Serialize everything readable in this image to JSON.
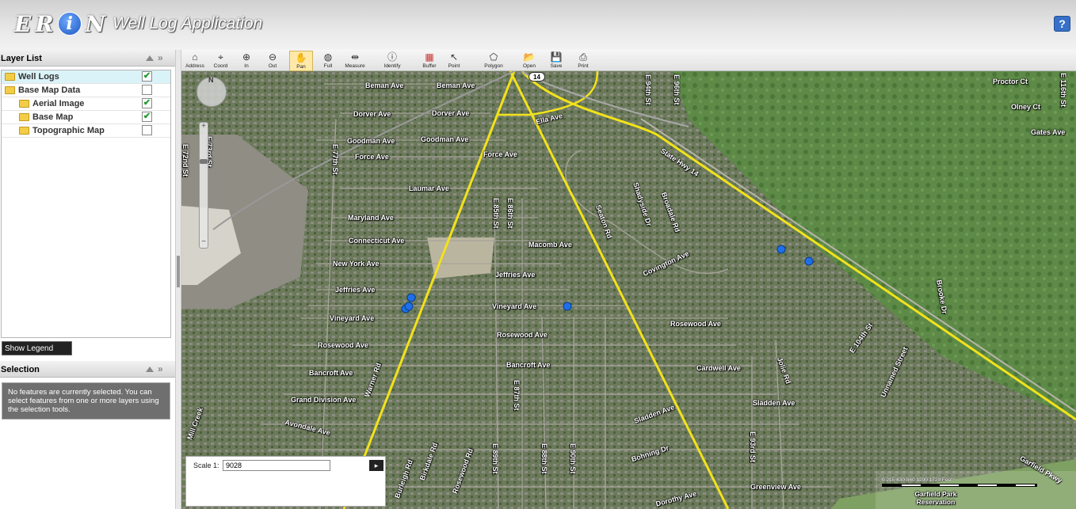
{
  "app": {
    "logo_letters": [
      "E",
      "R",
      "i",
      "N"
    ],
    "title": "Well Log Application",
    "help_label": "?"
  },
  "layer_list": {
    "title": "Layer List",
    "items": [
      {
        "label": "Well Logs",
        "checked": true,
        "selected": true
      },
      {
        "label": "Base Map Data",
        "checked": false
      },
      {
        "label": "Aerial Image",
        "checked": true
      },
      {
        "label": "Base Map",
        "checked": true
      },
      {
        "label": "Topographic Map",
        "checked": false
      }
    ],
    "show_legend_label": "Show Legend"
  },
  "selection": {
    "title": "Selection",
    "message": "No features are currently selected. You can select features from one or more layers using the selection tools."
  },
  "toolbar": {
    "tools": [
      {
        "label": "Address",
        "icon": "address-icon"
      },
      {
        "label": "Coord",
        "icon": "coord-icon"
      },
      {
        "label": "In",
        "icon": "zoom-in-icon"
      },
      {
        "label": "Out",
        "icon": "zoom-out-icon"
      },
      {
        "label": "Pan",
        "icon": "pan-icon",
        "active": true
      },
      {
        "label": "Full",
        "icon": "full-extent-icon"
      },
      {
        "label": "Measure",
        "icon": "measure-icon"
      },
      {
        "label": "Identify",
        "icon": "identify-icon"
      },
      {
        "label": "Buffer",
        "icon": "buffer-icon"
      },
      {
        "label": "Point",
        "icon": "point-icon"
      },
      {
        "label": "Polygon",
        "icon": "polygon-icon"
      },
      {
        "label": "Open",
        "icon": "open-icon"
      },
      {
        "label": "Save",
        "icon": "save-icon"
      },
      {
        "label": "Print",
        "icon": "print-icon"
      }
    ]
  },
  "map": {
    "nav_label": "N",
    "zoom_in": "+",
    "zoom_out": "−",
    "route_shield": "14",
    "scale_label": "Scale 1:",
    "scale_value": "9028",
    "scale_go": "▸",
    "scalebar_ticks": "0    215    430    860    1290    1720 Feet",
    "street_labels": {
      "beman1": "Beman Ave",
      "beman2": "Beman Ave",
      "dorver1": "Dorver Ave",
      "dorver2": "Dorver Ave",
      "goodman1": "Goodman Ave",
      "goodman2": "Goodman Ave",
      "force1": "Force Ave",
      "force2": "Force Ave",
      "laumar": "Laumar Ave",
      "maryland": "Maryland Ave",
      "connecticut": "Connecticut Ave",
      "newyork": "New York Ave",
      "jeffries1": "Jeffries Ave",
      "jeffries2": "Jeffries Ave",
      "vineyard1": "Vineyard Ave",
      "vineyard2": "Vineyard Ave",
      "rosewood1": "Rosewood Ave",
      "rosewood2": "Rosewood Ave",
      "rosewood3": "Rosewood Ave",
      "bancroft1": "Bancroft Ave",
      "bancroft2": "Bancroft Ave",
      "granddiv": "Grand Division Ave",
      "avondale": "Avondale Ave",
      "macomb": "Macomb Ave",
      "covington": "Covington Ave",
      "cardwell": "Cardwell Ave",
      "sladden1": "Sladden Ave",
      "sladden2": "Sladden Ave",
      "bohning": "Bohning Dr",
      "dorothy": "Dorothy Ave",
      "greenview": "Greenview Ave",
      "ella": "Ella Ave",
      "proctor": "Proctor Ct",
      "olney": "Olney Ct",
      "gates": "Gates Ave",
      "statehwy": "State Hwy 14",
      "e77": "E 77th St",
      "e72": "E 72nd St",
      "e73": "E 73rd St",
      "e85": "E 85th St",
      "e86": "E 86th St",
      "e87": "E 87th St",
      "e88": "E 88th St",
      "e89": "E 89th St",
      "e90": "E 90th St",
      "e93": "E 93rd St",
      "e94": "E 94th St",
      "e96": "E 96th St",
      "e104": "E 104th St",
      "e116": "E 116th St",
      "warner": "Warner Rd",
      "seaton": "Seaton Rd",
      "shadyside": "Shadyside Dr",
      "broadale": "Broadale Rd",
      "birkdale": "Birkdale Rd",
      "burleigh": "Burleigh Rd",
      "rosewood_rd": "Rosewood Rd",
      "jolie": "Jolie Rd",
      "brooke": "Brooke Dr",
      "unnamed": "Unnamed Street",
      "gerfield": "Garfield Pkwy",
      "mill": "Mill Creek",
      "park": "Garfield Park Reservation"
    }
  },
  "colors": {
    "road": "#f2e21b",
    "well": "#1e6fe8",
    "panel_sel": "#daf3f8"
  }
}
